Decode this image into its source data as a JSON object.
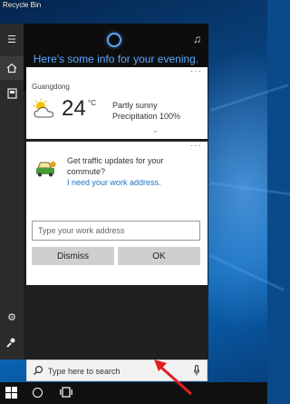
{
  "desktop": {
    "recycle_bin_label": "Recycle Bin"
  },
  "cortana": {
    "greeting": "Here's some info for your evening.",
    "accent_color": "#5aa9ff",
    "rail_items": [
      {
        "name": "menu-icon",
        "glyph": "☰"
      },
      {
        "name": "home-icon",
        "glyph": "⌂"
      },
      {
        "name": "notebook-icon",
        "glyph": "▣"
      },
      {
        "name": "settings-icon",
        "glyph": "⚙"
      },
      {
        "name": "feedback-icon",
        "glyph": "✎"
      }
    ]
  },
  "weather": {
    "location": "Guangdong",
    "temperature": "24",
    "unit": "°C",
    "condition": "Partly sunny",
    "precipitation": "Precipitation 100%",
    "more": "···",
    "expand": "⌄"
  },
  "traffic": {
    "question": "Get traffic updates for your commute?",
    "link": "I need your work address.",
    "more": "···",
    "input_placeholder": "Type your work address",
    "dismiss_label": "Dismiss",
    "ok_label": "OK"
  },
  "search": {
    "placeholder": "Type here to search"
  },
  "annotation": {
    "arrow_color": "#e02020"
  }
}
